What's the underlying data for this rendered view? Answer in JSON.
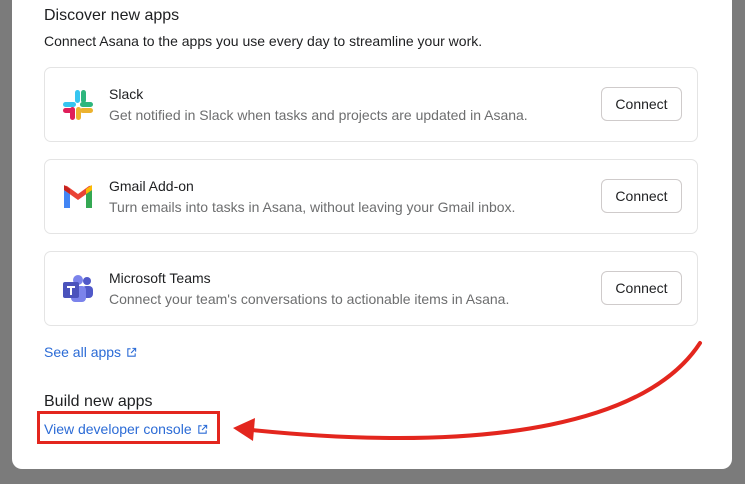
{
  "discover": {
    "title": "Discover new apps",
    "subtitle": "Connect Asana to the apps you use every day to streamline your work.",
    "apps": [
      {
        "name": "Slack",
        "description": "Get notified in Slack when tasks and projects are updated in Asana.",
        "button": "Connect",
        "icon": "slack-icon"
      },
      {
        "name": "Gmail Add-on",
        "description": "Turn emails into tasks in Asana, without leaving your Gmail inbox.",
        "button": "Connect",
        "icon": "gmail-icon"
      },
      {
        "name": "Microsoft Teams",
        "description": "Connect your team's conversations to actionable items in Asana.",
        "button": "Connect",
        "icon": "microsoft-teams-icon"
      }
    ],
    "see_all": "See all apps"
  },
  "build": {
    "title": "Build new apps",
    "developer_console": "View developer console"
  },
  "annotation": {
    "color": "#e3261e"
  },
  "colors": {
    "link": "#2b6bd6",
    "backdrop": "#7b7b7b"
  }
}
